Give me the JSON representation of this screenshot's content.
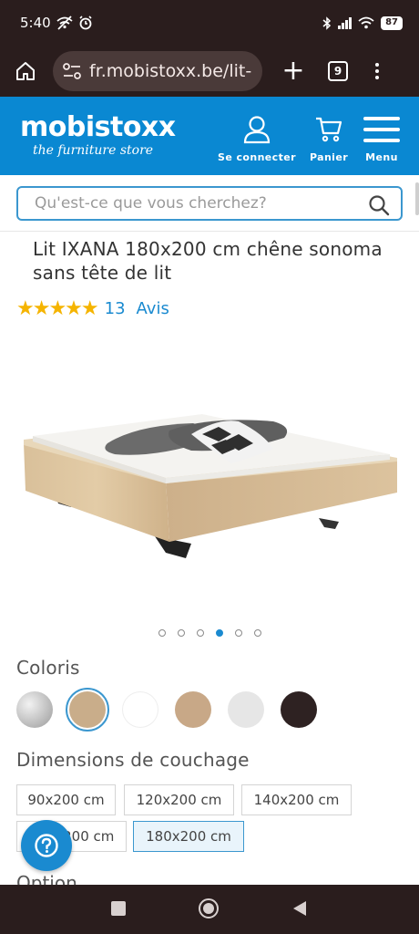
{
  "status_bar": {
    "time": "5:40",
    "battery": "87"
  },
  "browser": {
    "url": "fr.mobistoxx.be/lit-",
    "tab_count": "9"
  },
  "site": {
    "logo_text": "mobistoxx",
    "logo_tagline": "the furniture store",
    "login_label": "Se connecter",
    "cart_label": "Panier",
    "menu_label": "Menu",
    "brand_color": "#0a88d2"
  },
  "search": {
    "placeholder": "Qu'est-ce que vous cherchez?"
  },
  "product": {
    "title": "Lit IXANA 180x200 cm chêne sonoma sans tête de lit",
    "rating_stars": 5,
    "review_count": "13",
    "review_label": "Avis",
    "image_count": 6,
    "active_image_index": 3
  },
  "colors": {
    "label": "Coloris",
    "swatches": [
      {
        "name": "silver",
        "color": "#b8b8b8"
      },
      {
        "name": "oak-sonoma",
        "color": "#c9ad8a",
        "selected": true
      },
      {
        "name": "white",
        "color": "#ffffff"
      },
      {
        "name": "light-oak",
        "color": "#c8a887"
      },
      {
        "name": "white-grey",
        "color": "#e6e6e6"
      },
      {
        "name": "dark-brown",
        "color": "#2e2222"
      }
    ]
  },
  "dimensions": {
    "label": "Dimensions de couchage",
    "options": [
      {
        "label": "90x200 cm"
      },
      {
        "label": "120x200 cm"
      },
      {
        "label": "140x200 cm"
      },
      {
        "label": "160x200 cm"
      },
      {
        "label": "180x200 cm",
        "selected": true
      }
    ]
  },
  "option": {
    "label": "Option"
  }
}
